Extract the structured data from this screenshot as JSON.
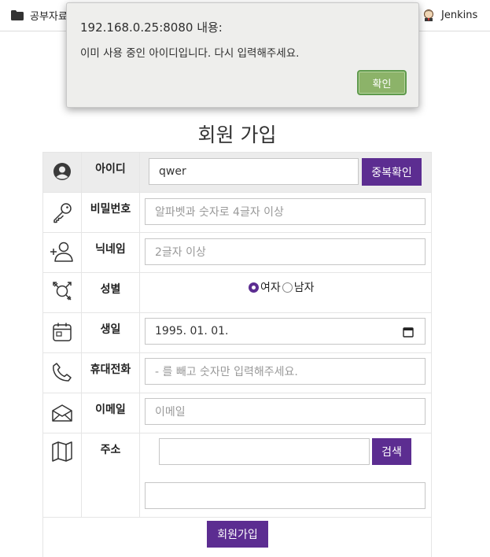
{
  "bookmarks": {
    "folder_label": "공부자료",
    "jenkins_label": "Jenkins"
  },
  "dialog": {
    "title": "192.168.0.25:8080 내용:",
    "message": "이미 사용 중인 아이디입니다. 다시 입력해주세요.",
    "ok_label": "확인"
  },
  "page": {
    "title": "회원 가입"
  },
  "form": {
    "id": {
      "label": "아이디",
      "value": "qwer",
      "check_button": "중복확인"
    },
    "password": {
      "label": "비밀번호",
      "placeholder": "알파벳과 숫자로 4글자 이상"
    },
    "nickname": {
      "label": "닉네임",
      "placeholder": "2글자 이상"
    },
    "gender": {
      "label": "성별",
      "options": [
        "여자",
        "남자"
      ],
      "selected": "여자"
    },
    "birthday": {
      "label": "생일",
      "value": "1995. 01. 01."
    },
    "phone": {
      "label": "휴대전화",
      "placeholder": "- 를 빼고 숫자만 입력해주세요."
    },
    "email": {
      "label": "이메일",
      "placeholder": "이메일"
    },
    "address": {
      "label": "주소",
      "search_button": "검색",
      "line1": "",
      "line2": ""
    },
    "submit_label": "회원가입"
  },
  "colors": {
    "accent": "#5c2d91",
    "ok_button": "#8cb369",
    "dialog_bg": "#eeeeec"
  }
}
